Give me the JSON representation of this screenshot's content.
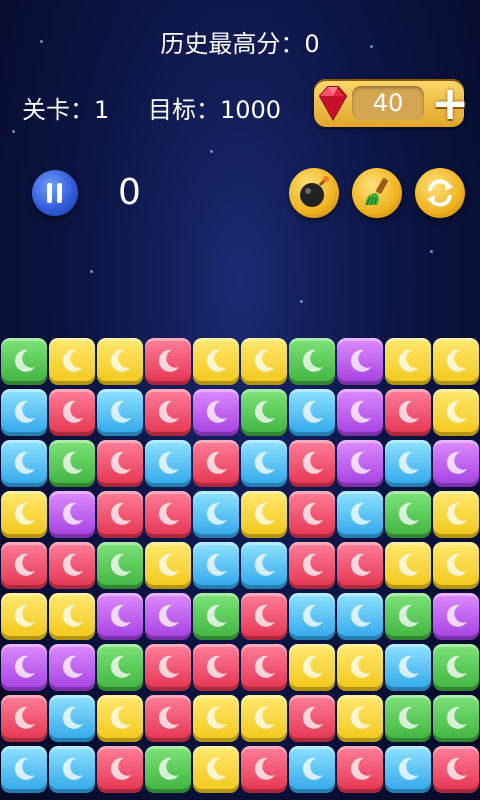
{
  "header": {
    "highscore_text": "历史最高分：0",
    "level_text": "关卡：1",
    "target_text": "目标：1000"
  },
  "gems": {
    "count": "40",
    "plus_label": "+"
  },
  "score": {
    "current": "0"
  },
  "tools": [
    {
      "name": "bomb-icon"
    },
    {
      "name": "brush-icon"
    },
    {
      "name": "refresh-icon"
    }
  ],
  "colors": {
    "g": "#4cc24a",
    "y": "#f5d22b",
    "r": "#ef4a66",
    "p": "#b454ea",
    "b": "#3fb3f0"
  },
  "board": [
    [
      "g",
      "y",
      "y",
      "r",
      "y",
      "y",
      "g",
      "p",
      "y",
      "y"
    ],
    [
      "b",
      "r",
      "b",
      "r",
      "p",
      "g",
      "b",
      "p",
      "r",
      "y"
    ],
    [
      "b",
      "g",
      "r",
      "b",
      "r",
      "b",
      "r",
      "p",
      "b",
      "p"
    ],
    [
      "y",
      "p",
      "r",
      "r",
      "b",
      "y",
      "r",
      "b",
      "g",
      "y"
    ],
    [
      "r",
      "r",
      "g",
      "y",
      "b",
      "b",
      "r",
      "r",
      "y",
      "y"
    ],
    [
      "y",
      "y",
      "p",
      "p",
      "g",
      "r",
      "b",
      "b",
      "g",
      "p"
    ],
    [
      "p",
      "p",
      "g",
      "r",
      "r",
      "r",
      "y",
      "y",
      "b",
      "g"
    ],
    [
      "r",
      "b",
      "y",
      "r",
      "y",
      "y",
      "r",
      "y",
      "g",
      "g"
    ],
    [
      "b",
      "b",
      "r",
      "g",
      "y",
      "r",
      "b",
      "r",
      "b",
      "r"
    ]
  ]
}
